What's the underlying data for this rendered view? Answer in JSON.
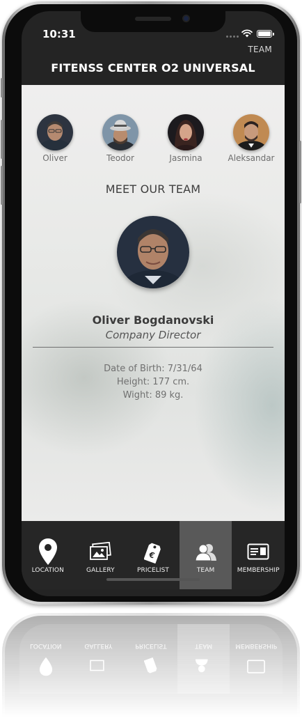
{
  "status_bar": {
    "time": "10:31"
  },
  "header": {
    "tab_name": "TEAM",
    "title": "FITENSS CENTER O2 UNIVERSAL"
  },
  "team": {
    "members": [
      {
        "name": "Oliver"
      },
      {
        "name": "Teodor"
      },
      {
        "name": "Jasmina"
      },
      {
        "name": "Aleksandar"
      }
    ],
    "section_title": "MEET OUR TEAM",
    "selected": {
      "full_name": "Oliver Bogdanovski",
      "role": "Company Director",
      "date_of_birth": "Date of Birth: 7/31/64",
      "height": "Height: 177 cm.",
      "weight": "Wight: 89 kg."
    }
  },
  "tabbar": {
    "items": [
      {
        "label": "LOCATION",
        "icon": "location-pin-icon"
      },
      {
        "label": "GALLERY",
        "icon": "gallery-icon"
      },
      {
        "label": "PRICELIST",
        "icon": "price-tag-icon"
      },
      {
        "label": "TEAM",
        "icon": "team-icon",
        "active": true
      },
      {
        "label": "MEMBERSHIP",
        "icon": "membership-card-icon"
      }
    ]
  },
  "colors": {
    "header_bg": "#242424",
    "tabbar_bg": "#262626",
    "tab_active_bg": "#595959",
    "title_text": "#ffffff"
  }
}
